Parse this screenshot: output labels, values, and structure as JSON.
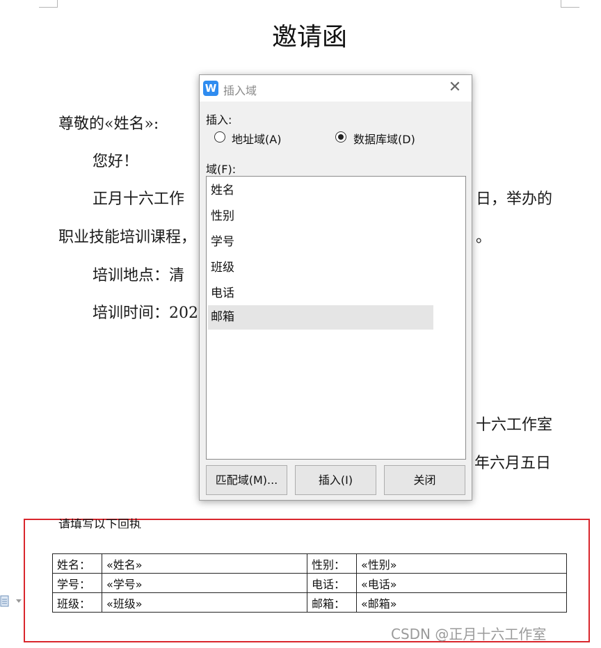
{
  "document": {
    "title": "邀请函",
    "salutation": "尊敬的«姓名»:",
    "greeting": "您好！",
    "para1_start": "正月十六工作",
    "para1_end": "日，举办的",
    "para2_start": "职业技能培训课程，",
    "para2_end": "。",
    "location_line": "培训地点：清",
    "time_line": "培训时间：202",
    "signature_org": "十六工作室",
    "signature_date": "年六月五日"
  },
  "reply": {
    "label": "请填写以下回执",
    "rows": [
      [
        {
          "k": "姓名：",
          "v": "«姓名»"
        },
        {
          "k": "性别：",
          "v": "«性别»"
        }
      ],
      [
        {
          "k": "学号：",
          "v": "«学号»"
        },
        {
          "k": "电话：",
          "v": "«电话»"
        }
      ],
      [
        {
          "k": "班级：",
          "v": "«班级»"
        },
        {
          "k": "邮箱：",
          "v": "«邮箱»"
        }
      ]
    ]
  },
  "dialog": {
    "app_icon": "W",
    "title": "插入域",
    "insert_label": "插入:",
    "radio_address": "地址域(A)",
    "radio_database": "数据库域(D)",
    "selected_radio": "database",
    "fields_label": "域(F):",
    "fields": [
      "姓名",
      "性别",
      "学号",
      "班级",
      "电话",
      "邮箱"
    ],
    "selected_field": "邮箱",
    "buttons": {
      "match": "匹配域(M)...",
      "insert": "插入(I)",
      "close": "关闭"
    }
  },
  "watermark": "CSDN @正月十六工作室",
  "colors": {
    "reply_border": "#d9262c",
    "app_icon": "#2f8cf0",
    "selection": "#e5e5e5"
  }
}
